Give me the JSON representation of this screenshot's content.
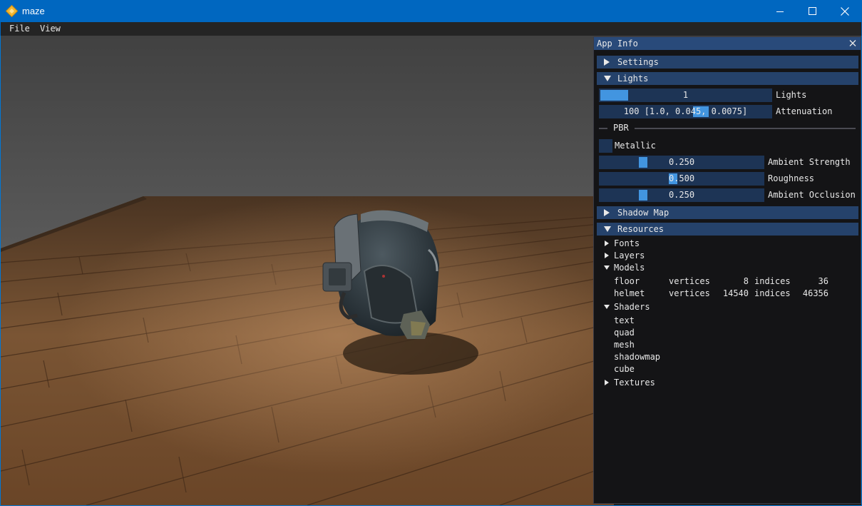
{
  "window": {
    "title": "maze",
    "controls": {
      "minimize_icon": "minimize-icon",
      "maximize_icon": "maximize-icon",
      "close_icon": "close-icon"
    }
  },
  "menu": {
    "items": [
      "File",
      "View"
    ]
  },
  "panel": {
    "title": "App Info",
    "sections": {
      "settings": "Settings",
      "lights": "Lights",
      "shadow_map": "Shadow Map",
      "resources": "Resources"
    },
    "lights": {
      "count_value": "1",
      "count_fill": 0.18,
      "count_label": "Lights",
      "attenuation_value": "100 [1.0, 0.045, 0.0075]",
      "attenuation_label": "Attenuation"
    },
    "pbr": {
      "heading": "PBR",
      "metallic_label": "Metallic",
      "metallic_checked": false,
      "ambient_strength_value": "0.250",
      "ambient_strength_label": "Ambient Strength",
      "roughness_value": "0.500",
      "roughness_label": "Roughness",
      "ambient_occlusion_value": "0.250",
      "ambient_occlusion_label": "Ambient Occlusion"
    },
    "resources": {
      "fonts": "Fonts",
      "layers": "Layers",
      "models": "Models",
      "model_rows": [
        {
          "name": "floor",
          "vertices_label": "vertices",
          "vertices": "8",
          "indices_label": "indices",
          "indices": "36"
        },
        {
          "name": "helmet",
          "vertices_label": "vertices",
          "vertices": "14540",
          "indices_label": "indices",
          "indices": "46356"
        }
      ],
      "shaders": "Shaders",
      "shader_items": [
        "text",
        "quad",
        "mesh",
        "shadowmap",
        "cube"
      ],
      "textures": "Textures"
    }
  },
  "colors": {
    "titlebar": "#0067c0",
    "panel_header": "#25426b",
    "slider_grab": "#4295e0",
    "panel_bg": "#141416"
  }
}
